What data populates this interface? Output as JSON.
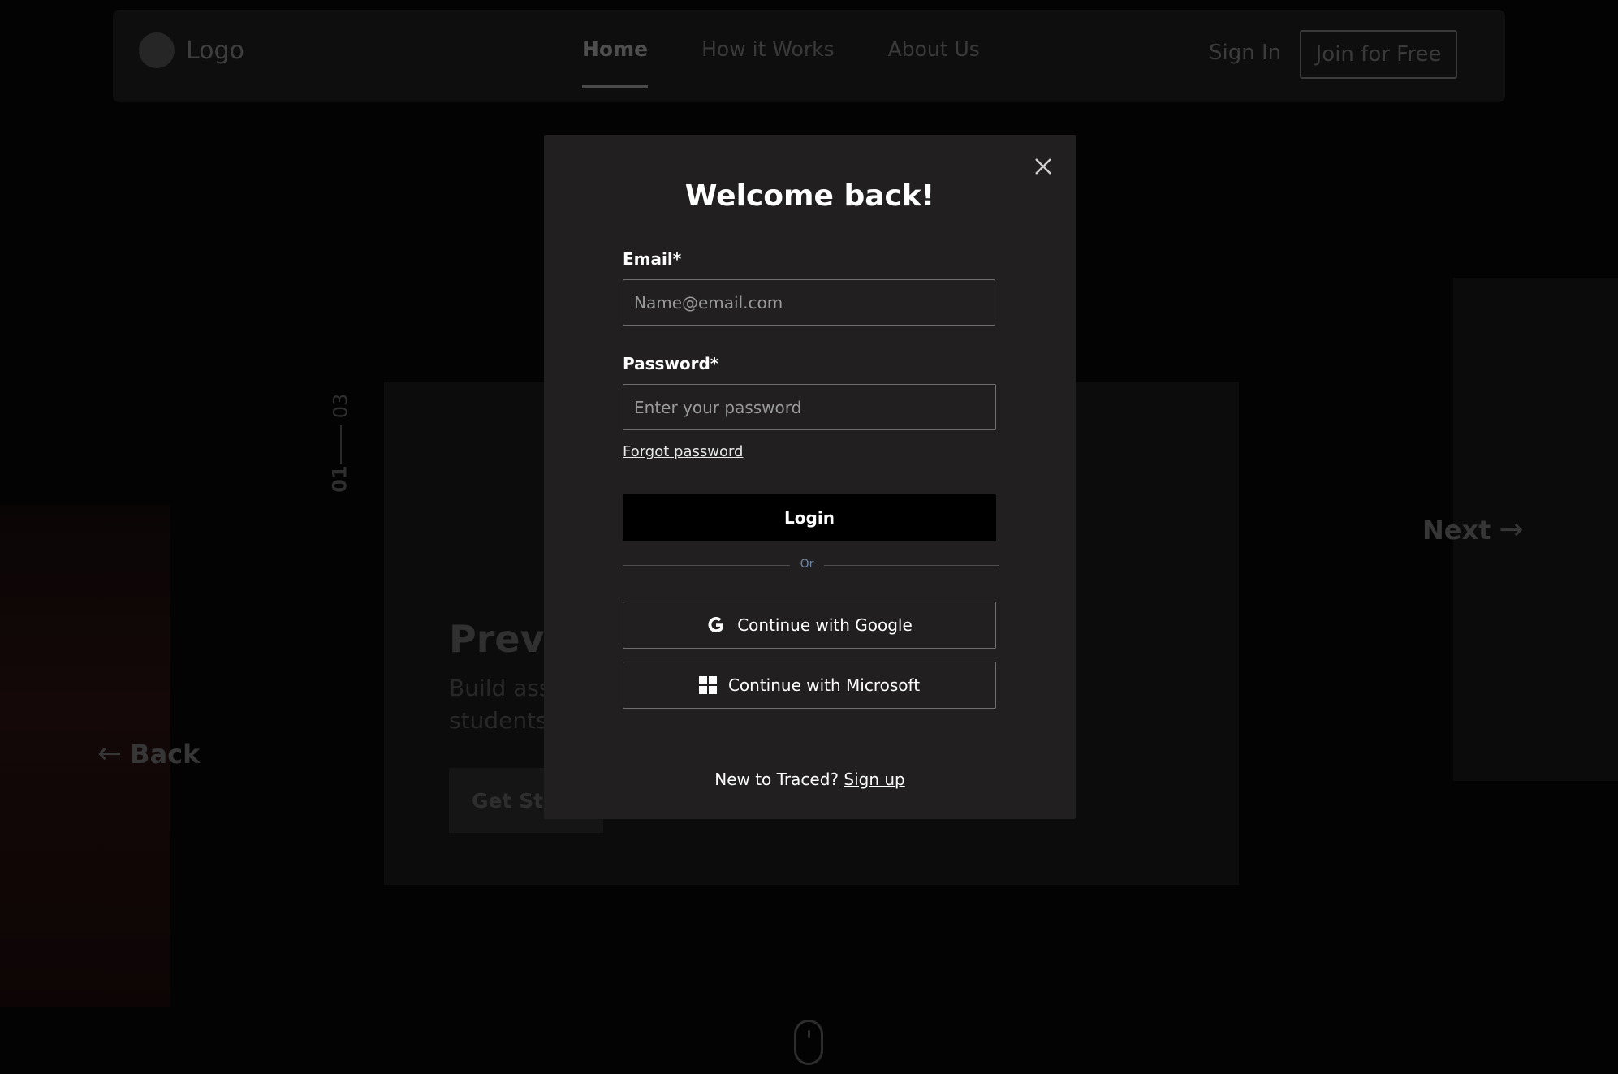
{
  "navbar": {
    "logo_text": "Logo",
    "links": [
      "Home",
      "How it Works",
      "About Us"
    ],
    "active_link": "Home",
    "sign_in": "Sign In",
    "join": "Join for Free"
  },
  "hero": {
    "slide_current": "01",
    "slide_total": "03",
    "title": "Preve",
    "description_line1": "Build assi",
    "description_line2": "students",
    "cta": "Get Star",
    "back_label": "Back",
    "next_label": "Next",
    "back_arrow": "←",
    "next_arrow": "→"
  },
  "modal": {
    "title": "Welcome back!",
    "email_label": "Email*",
    "email_placeholder": "Name@email.com",
    "password_label": "Password*",
    "password_placeholder": "Enter your password",
    "forgot_label": "Forgot password",
    "login_label": "Login",
    "divider_text": "Or",
    "google_label": "Continue with Google",
    "microsoft_label": "Continue with Microsoft",
    "signup_prompt": "New to Traced?",
    "signup_link": "Sign up"
  },
  "icons": {
    "close": "close-icon",
    "google": "google-icon",
    "microsoft": "microsoft-icon",
    "mouse": "scroll-mouse-icon"
  },
  "colors": {
    "modal_bg": "#211f1f",
    "overlay_bg": "#030303",
    "button_primary": "#000000",
    "input_border": "#6f6f6f",
    "divider_text": "#6f86a8"
  }
}
